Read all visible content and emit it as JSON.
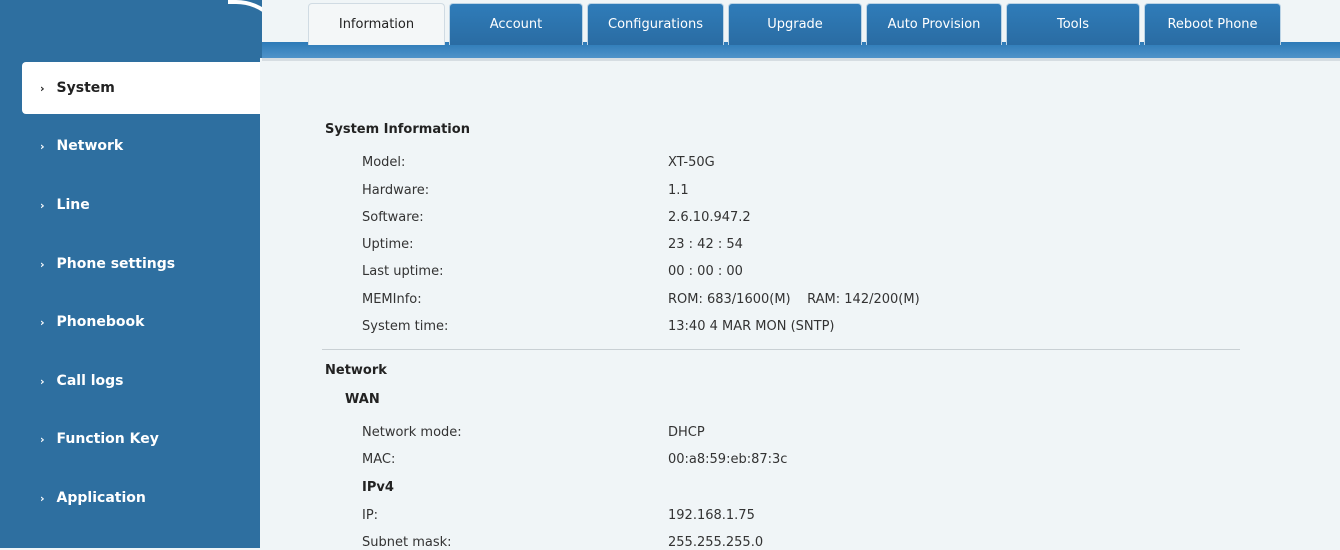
{
  "tabs": [
    "Information",
    "Account",
    "Configurations",
    "Upgrade",
    "Auto Provision",
    "Tools",
    "Reboot Phone"
  ],
  "active_tab": "Information",
  "sidebar": {
    "items": [
      "System",
      "Network",
      "Line",
      "Phone settings",
      "Phonebook",
      "Call logs",
      "Function Key",
      "Application"
    ],
    "active": "System",
    "chevron": "›"
  },
  "system_info": {
    "title": "System Information",
    "rows": [
      {
        "label": "Model:",
        "value": "XT-50G"
      },
      {
        "label": "Hardware:",
        "value": "1.1"
      },
      {
        "label": "Software:",
        "value": "2.6.10.947.2"
      },
      {
        "label": "Uptime:",
        "value": "23 : 42 : 54"
      },
      {
        "label": "Last uptime:",
        "value": "00 : 00 : 00"
      },
      {
        "label": "MEMInfo:",
        "value": "ROM: 683/1600(M)    RAM: 142/200(M)"
      },
      {
        "label": "System time:",
        "value": "13:40 4 MAR MON (SNTP)"
      }
    ]
  },
  "network": {
    "title": "Network",
    "wan_title": "WAN",
    "rows": [
      {
        "label": "Network mode:",
        "value": "DHCP"
      },
      {
        "label": "MAC:",
        "value": "00:a8:59:eb:87:3c"
      }
    ],
    "ipv4_title": "IPv4",
    "ipv4_rows": [
      {
        "label": "IP:",
        "value": "192.168.1.75"
      },
      {
        "label": "Subnet mask:",
        "value": "255.255.255.0"
      }
    ]
  },
  "colors": {
    "sidebar": "#2e6fa0",
    "tab": "#2f7cb9",
    "content_bg": "#f0f5f7"
  }
}
